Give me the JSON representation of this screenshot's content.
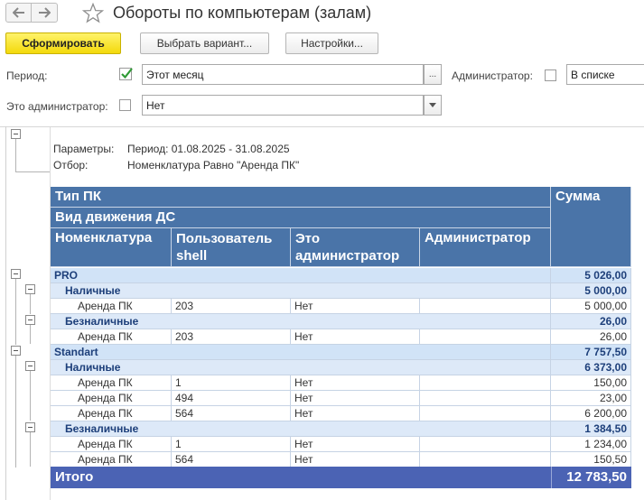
{
  "window": {
    "title": "Обороты по компьютерам (залам)"
  },
  "toolbar": {
    "generate": "Сформировать",
    "choose_variant": "Выбрать вариант...",
    "settings": "Настройки..."
  },
  "filters": {
    "period_label": "Период:",
    "period_checked": true,
    "period_value": "Этот месяц",
    "period_btn": "...",
    "admin_label": "Администратор:",
    "admin_checked": false,
    "admin_value": "В списке",
    "is_admin_label": "Это администратор:",
    "is_admin_checked": false,
    "is_admin_value": "Нет"
  },
  "report": {
    "params_label": "Параметры:",
    "params_value": "Период: 01.08.2025 - 31.08.2025",
    "filter_label": "Отбор:",
    "filter_value": "Номенклатура Равно \"Аренда ПК\"",
    "columns": {
      "pc_type": "Тип ПК",
      "flow_type": "Вид движения ДС",
      "nomenclature": "Номенклатура",
      "user_shell_1": "Пользователь",
      "user_shell_2": "shell",
      "is_admin_1": "Это",
      "is_admin_2": "администратор",
      "admin": "Администратор",
      "sum": "Сумма"
    },
    "rows": [
      {
        "level": 1,
        "name": "PRO",
        "sum": "5 026,00"
      },
      {
        "level": 2,
        "name": "Наличные",
        "sum": "5 000,00"
      },
      {
        "level": 3,
        "name": "Аренда ПК",
        "user": "203",
        "is_admin": "Нет",
        "sum": "5 000,00"
      },
      {
        "level": 2,
        "name": "Безналичные",
        "sum": "26,00"
      },
      {
        "level": 3,
        "name": "Аренда ПК",
        "user": "203",
        "is_admin": "Нет",
        "sum": "26,00"
      },
      {
        "level": 1,
        "name": "Standart",
        "sum": "7 757,50"
      },
      {
        "level": 2,
        "name": "Наличные",
        "sum": "6 373,00"
      },
      {
        "level": 3,
        "name": "Аренда ПК",
        "user": "1",
        "is_admin": "Нет",
        "sum": "150,00"
      },
      {
        "level": 3,
        "name": "Аренда ПК",
        "user": "494",
        "is_admin": "Нет",
        "sum": "23,00"
      },
      {
        "level": 3,
        "name": "Аренда ПК",
        "user": "564",
        "is_admin": "Нет",
        "sum": "6 200,00"
      },
      {
        "level": 2,
        "name": "Безналичные",
        "sum": "1 384,50"
      },
      {
        "level": 3,
        "name": "Аренда ПК",
        "user": "1",
        "is_admin": "Нет",
        "sum": "1 234,00"
      },
      {
        "level": 3,
        "name": "Аренда ПК",
        "user": "564",
        "is_admin": "Нет",
        "sum": "150,50"
      }
    ],
    "total_label": "Итого",
    "total_sum": "12 783,50"
  }
}
